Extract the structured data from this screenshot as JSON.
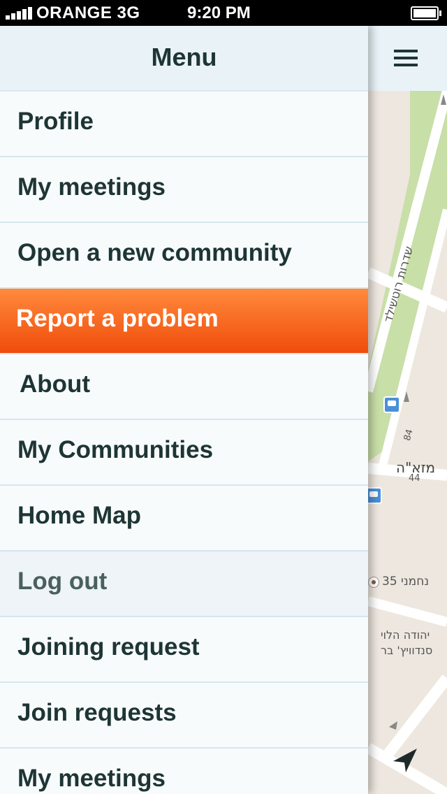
{
  "status_bar": {
    "carrier": "ORANGE",
    "network": "3G",
    "time": "9:20 PM"
  },
  "menu": {
    "title": "Menu",
    "items": [
      {
        "label": "Profile"
      },
      {
        "label": "My meetings"
      },
      {
        "label": "Open a new community"
      },
      {
        "label": "Report a problem",
        "state": "active"
      },
      {
        "label": "About"
      },
      {
        "label": "My Communities"
      },
      {
        "label": "Home Map"
      },
      {
        "label": "Log out",
        "state": "pressed"
      },
      {
        "label": "Joining request"
      },
      {
        "label": "Join requests"
      },
      {
        "label": "My meetings"
      }
    ]
  },
  "map": {
    "labels": {
      "street_rothschild": "שדרות רוטשילד",
      "street_ahad_haam": "מזא\"ה",
      "house_number_84": "84",
      "house_number_44": "44",
      "address_nahmani": "נחמני 35",
      "poi_line1": "יהודה הלוי",
      "poi_line2": "סנדוויץ' בר"
    },
    "icons": [
      "bus-stop-icon",
      "bus-stop-icon",
      "poi-icon",
      "navigation-arrow-icon",
      "menu-icon"
    ]
  },
  "colors": {
    "accent": "#f3600f",
    "menu_text": "#1e3535",
    "menu_bg": "#f8fbfc",
    "header_bg": "#e9f3f7",
    "map_green": "#c8dfa8",
    "map_bg": "#ede7df"
  }
}
